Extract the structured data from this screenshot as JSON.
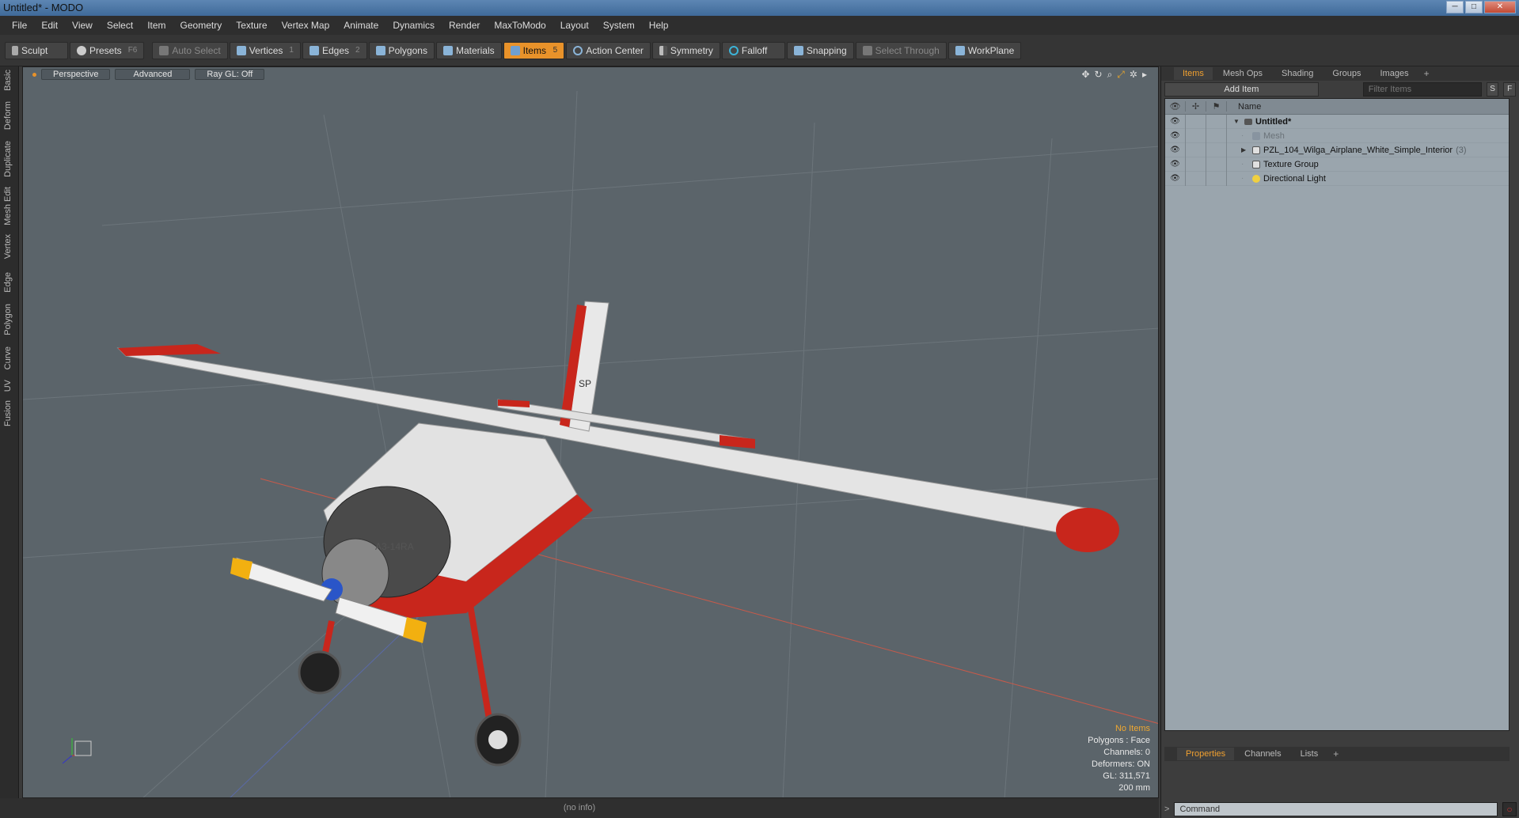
{
  "window": {
    "title": "Untitled* - MODO",
    "minimize": "─",
    "maximize": "□",
    "close": "✕"
  },
  "menu": [
    "File",
    "Edit",
    "View",
    "Select",
    "Item",
    "Geometry",
    "Texture",
    "Vertex Map",
    "Animate",
    "Dynamics",
    "Render",
    "MaxToModo",
    "Layout",
    "System",
    "Help"
  ],
  "toolbar": {
    "sculpt": "Sculpt",
    "presets": "Presets",
    "presets_key": "F6",
    "auto_select": "Auto Select",
    "vertices": "Vertices",
    "vertices_key": "1",
    "edges": "Edges",
    "edges_key": "2",
    "polygons": "Polygons",
    "materials": "Materials",
    "items": "Items",
    "items_key": "5",
    "action_center": "Action Center",
    "symmetry": "Symmetry",
    "falloff": "Falloff",
    "snapping": "Snapping",
    "select_through": "Select Through",
    "workplane": "WorkPlane"
  },
  "left_tabs": [
    "Basic",
    "Deform",
    "Duplicate",
    "Mesh Edit",
    "Vertex",
    "Edge",
    "Polygon",
    "Curve",
    "UV",
    "Fusion"
  ],
  "viewport": {
    "view_mode": "Perspective",
    "shading": "Advanced",
    "ray_gl": "Ray GL: Off",
    "info": {
      "selection": "No Items",
      "polygons": "Polygons : Face",
      "channels": "Channels: 0",
      "deformers": "Deformers: ON",
      "gl": "GL: 311,571",
      "scale": "200 mm"
    },
    "decal_left": "A3-14RA",
    "decal_tail": "SP"
  },
  "status": "(no info)",
  "panel": {
    "tabs": [
      "Items",
      "Mesh Ops",
      "Shading",
      "Groups",
      "Images"
    ],
    "add_item": "Add Item",
    "filter_placeholder": "Filter Items",
    "s_btn": "S",
    "f_btn": "F",
    "name_header": "Name",
    "tree": [
      {
        "label": "Untitled*",
        "bold": true
      },
      {
        "label": "Mesh",
        "dim": true
      },
      {
        "label": "PZL_104_Wilga_Airplane_White_Simple_Interior",
        "count": "(3)"
      },
      {
        "label": "Texture Group"
      },
      {
        "label": "Directional Light"
      }
    ],
    "bottom_tabs": [
      "Properties",
      "Channels",
      "Lists"
    ],
    "command_placeholder": "Command",
    "command_prompt": ">"
  },
  "colors": {
    "accent": "#e8922a",
    "viewport_bg": "#5b646a",
    "plane_red": "#c8261c",
    "plane_white": "#e9e9e9"
  }
}
